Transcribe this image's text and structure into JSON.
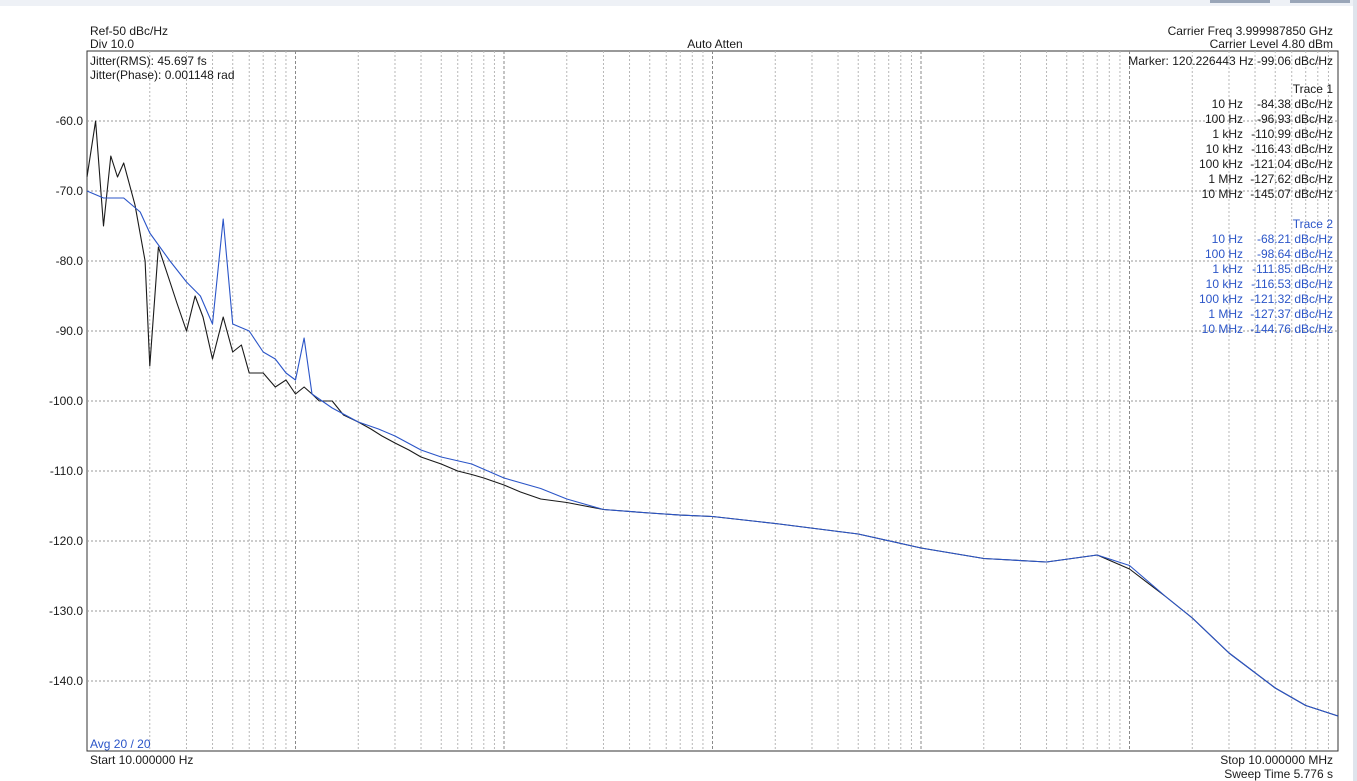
{
  "header": {
    "ref": "Ref-50 dBc/Hz",
    "div": "Div 10.0",
    "center": "Auto Atten",
    "carrier_freq": "Carrier Freq 3.999987850 GHz",
    "carrier_level": "Carrier Level 4.80 dBm",
    "jitter_rms": "Jitter(RMS): 45.697 fs",
    "jitter_phase": "Jitter(Phase): 0.001148 rad",
    "marker": "Marker: 120.226443 Hz -99.06 dBc/Hz"
  },
  "footer": {
    "avg": "Avg 20 / 20",
    "start": "Start 10.000000 Hz",
    "stop": "Stop 10.000000 MHz",
    "sweep": "Sweep Time 5.776 s"
  },
  "trace_tables": [
    {
      "title": "Trace 1",
      "color": "#1a1a1a",
      "rows": [
        {
          "freq": "10 Hz",
          "value": "-84.38 dBc/Hz"
        },
        {
          "freq": "100 Hz",
          "value": "-96.93 dBc/Hz"
        },
        {
          "freq": "1 kHz",
          "value": "-110.99 dBc/Hz"
        },
        {
          "freq": "10 kHz",
          "value": "-116.43 dBc/Hz"
        },
        {
          "freq": "100 kHz",
          "value": "-121.04 dBc/Hz"
        },
        {
          "freq": "1 MHz",
          "value": "-127.62 dBc/Hz"
        },
        {
          "freq": "10 MHz",
          "value": "-145.07 dBc/Hz"
        }
      ]
    },
    {
      "title": "Trace 2",
      "color": "#2b55c8",
      "rows": [
        {
          "freq": "10 Hz",
          "value": "-68.21 dBc/Hz"
        },
        {
          "freq": "100 Hz",
          "value": "-98.64 dBc/Hz"
        },
        {
          "freq": "1 kHz",
          "value": "-111.85 dBc/Hz"
        },
        {
          "freq": "10 kHz",
          "value": "-116.53 dBc/Hz"
        },
        {
          "freq": "100 kHz",
          "value": "-121.32 dBc/Hz"
        },
        {
          "freq": "1 MHz",
          "value": "-127.37 dBc/Hz"
        },
        {
          "freq": "10 MHz",
          "value": "-144.76 dBc/Hz"
        }
      ]
    }
  ],
  "chart_data": {
    "type": "line",
    "xscale": "log",
    "xlim": [
      10,
      10000000
    ],
    "ylim": [
      -150,
      -50
    ],
    "yticks": [
      "-60.0",
      "-70.0",
      "-80.0",
      "-90.0",
      "-100.0",
      "-110.0",
      "-120.0",
      "-130.0",
      "-140.0"
    ],
    "grid": true,
    "series": [
      {
        "name": "Trace 1",
        "color": "#1a1a1a",
        "x": [
          10,
          11,
          12,
          13,
          14,
          15,
          17,
          19,
          20,
          22,
          25,
          27,
          30,
          33,
          36,
          40,
          45,
          50,
          55,
          60,
          70,
          80,
          90,
          100,
          110,
          120,
          130,
          150,
          170,
          200,
          230,
          260,
          300,
          350,
          400,
          500,
          600,
          700,
          800,
          1000,
          1200,
          1500,
          2000,
          3000,
          5000,
          7000,
          10000,
          20000,
          50000,
          100000,
          200000,
          400000,
          700000,
          1000000,
          1500000,
          2000000,
          3000000,
          5000000,
          7000000,
          10000000
        ],
        "y": [
          -68,
          -60,
          -75,
          -65,
          -68,
          -66,
          -72,
          -80,
          -95,
          -78,
          -83,
          -86,
          -90,
          -85,
          -88,
          -94,
          -88,
          -93,
          -92,
          -96,
          -96,
          -98,
          -97,
          -99,
          -98,
          -99,
          -100,
          -100,
          -102,
          -103,
          -104,
          -105,
          -106,
          -107,
          -108,
          -109,
          -110,
          -110.5,
          -111,
          -112,
          -113,
          -114,
          -114.5,
          -115.5,
          -116,
          -116.3,
          -116.5,
          -117.5,
          -119,
          -121,
          -122.5,
          -123,
          -122,
          -124,
          -128,
          -131,
          -136,
          -141,
          -143.5,
          -145
        ]
      },
      {
        "name": "Trace 2",
        "color": "#2b55c8",
        "x": [
          10,
          12,
          15,
          18,
          20,
          25,
          30,
          35,
          40,
          45,
          50,
          60,
          70,
          80,
          90,
          100,
          110,
          120,
          150,
          200,
          250,
          300,
          400,
          500,
          700,
          1000,
          1500,
          2000,
          3000,
          5000,
          7000,
          10000,
          20000,
          50000,
          100000,
          200000,
          400000,
          700000,
          1000000,
          1500000,
          2000000,
          3000000,
          5000000,
          7000000,
          10000000
        ],
        "y": [
          -70,
          -71,
          -71,
          -73,
          -76,
          -80,
          -83,
          -85,
          -89,
          -74,
          -89,
          -90,
          -93,
          -94,
          -96,
          -97,
          -91,
          -99,
          -101,
          -103,
          -104,
          -105,
          -107,
          -108,
          -109,
          -111,
          -112.5,
          -114,
          -115.5,
          -116,
          -116.3,
          -116.5,
          -117.5,
          -119,
          -121,
          -122.5,
          -123,
          -122,
          -123.5,
          -128,
          -131,
          -136,
          -141,
          -143.5,
          -145
        ]
      }
    ]
  }
}
